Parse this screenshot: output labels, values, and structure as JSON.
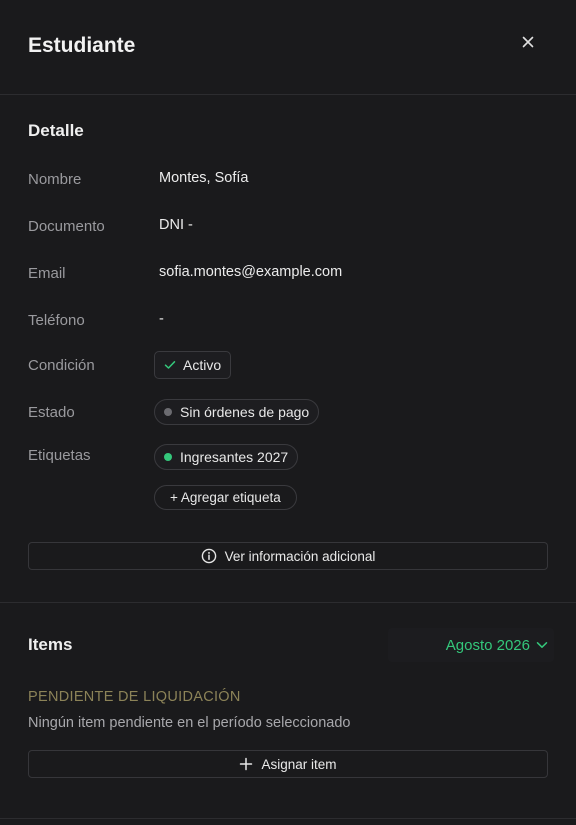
{
  "header": {
    "title": "Estudiante",
    "close_icon": "close-icon"
  },
  "detail": {
    "title": "Detalle",
    "fields": {
      "nombre": {
        "label": "Nombre",
        "value": "Montes, Sofía"
      },
      "documento": {
        "label": "Documento",
        "value": "DNI -"
      },
      "email": {
        "label": "Email",
        "value": "sofia.montes@example.com"
      },
      "telefono": {
        "label": "Teléfono",
        "value": "-"
      },
      "condicion": {
        "label": "Condición",
        "value": "Activo",
        "icon": "check-icon",
        "color": "#34c77b"
      },
      "estado": {
        "label": "Estado",
        "value": "Sin órdenes de pago",
        "dot_color": "#6b6b70"
      },
      "etiquetas": {
        "label": "Etiquetas",
        "tags": [
          "Ingresantes 2027"
        ],
        "dot_color": "#34c77b",
        "add_label": "+ Agregar etiqueta"
      }
    },
    "more_info_label": "Ver información adicional",
    "more_info_icon": "info-icon"
  },
  "items": {
    "title": "Items",
    "period_label": "Agosto 2026",
    "period_icon": "chevron-down-icon",
    "accent_color": "#34c77b",
    "pending_heading": "PENDIENTE DE LIQUIDACIÓN",
    "pending_heading_color": "#8c8358",
    "pending_empty": "Ningún item pendiente en el período seleccionado",
    "assign_label": "Asignar item",
    "assign_icon": "plus-icon"
  }
}
